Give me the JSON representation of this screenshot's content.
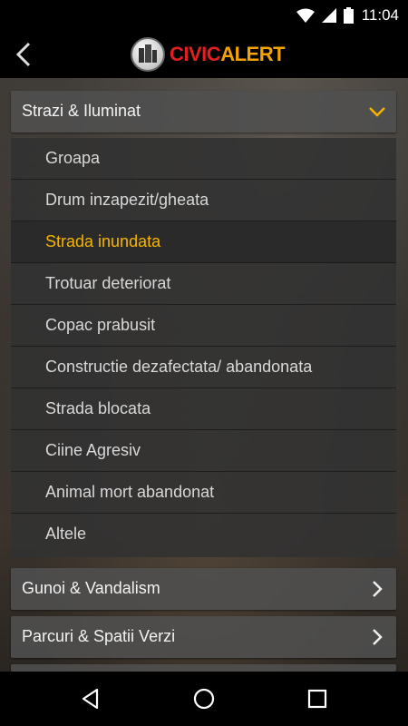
{
  "status_bar": {
    "time": "11:04",
    "icons": [
      "wifi-icon",
      "signal-icon",
      "battery-icon"
    ]
  },
  "app_bar": {
    "logo_part1": "CIVIC",
    "logo_part2": "ALERT"
  },
  "colors": {
    "accent": "#f5b400",
    "logo_red": "#e02020",
    "logo_orange": "#f5a300"
  },
  "categories": [
    {
      "label": "Strazi & Iluminat",
      "expanded": true,
      "icon": "chevron-down-icon"
    },
    {
      "label": "Gunoi & Vandalism",
      "expanded": false,
      "icon": "chevron-right-icon"
    },
    {
      "label": "Parcuri & Spatii Verzi",
      "expanded": false,
      "icon": "chevron-right-icon"
    }
  ],
  "subitems": [
    {
      "label": "Groapa"
    },
    {
      "label": "Drum inzapezit/gheata"
    },
    {
      "label": "Strada inundata",
      "selected": true
    },
    {
      "label": "Trotuar deteriorat"
    },
    {
      "label": "Copac prabusit"
    },
    {
      "label": "Constructie dezafectata/ abandonata"
    },
    {
      "label": "Strada blocata"
    },
    {
      "label": "Ciine Agresiv"
    },
    {
      "label": "Animal mort abandonat"
    },
    {
      "label": "Altele"
    }
  ],
  "nav_bar": {
    "buttons": [
      "back-nav-icon",
      "home-nav-icon",
      "recents-nav-icon"
    ]
  }
}
